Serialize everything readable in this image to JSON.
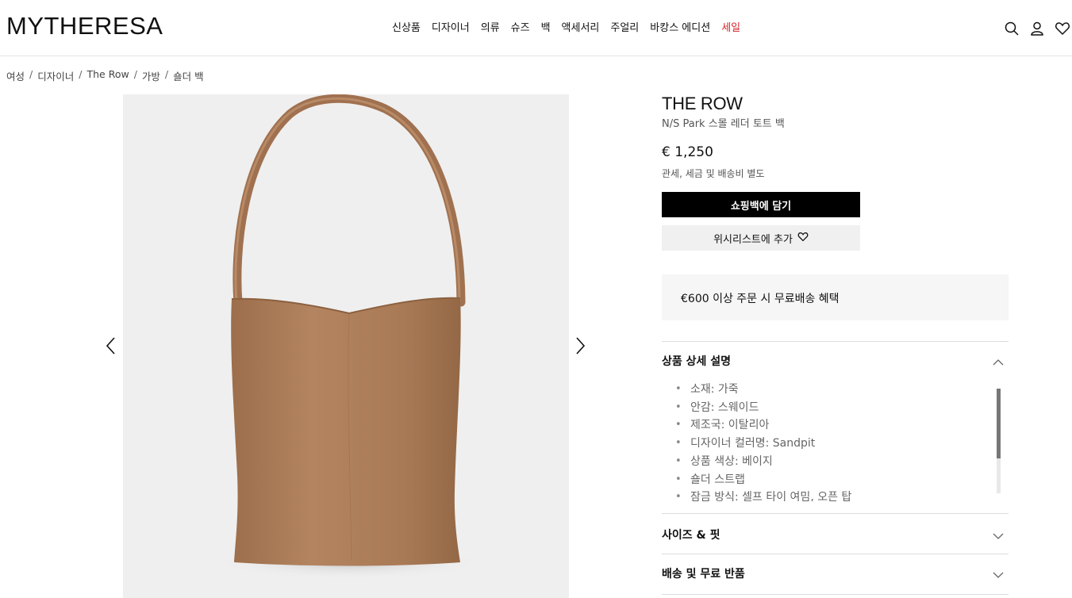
{
  "header": {
    "logo": "MYTHERESA",
    "nav": [
      {
        "label": "신상품"
      },
      {
        "label": "디자이너"
      },
      {
        "label": "의류"
      },
      {
        "label": "슈즈"
      },
      {
        "label": "백"
      },
      {
        "label": "액세서리"
      },
      {
        "label": "주얼리"
      },
      {
        "label": "바캉스 에디션"
      },
      {
        "label": "세일"
      }
    ],
    "icons": [
      "search-icon",
      "account-icon",
      "wishlist-icon"
    ]
  },
  "breadcrumb": [
    "여성",
    "디자이너",
    "The Row",
    "가방",
    "숄더 백"
  ],
  "product": {
    "brand": "THE ROW",
    "name": "N/S Park 스몰 레더 토트 백",
    "price": "€ 1,250",
    "tax_note": "관세, 세금 및 배송비 별도",
    "add_to_bag": "쇼핑백에 담기",
    "add_to_wishlist": "위시리스트에 추가",
    "promo": "€600 이상 주문 시 무료배송 혜택",
    "image_color": "#a97a56"
  },
  "accordion": {
    "details_title": "상품 상세 설명",
    "details": [
      "소재: 가죽",
      "안감: 스웨이드",
      "제조국: 이탈리아",
      "디자이너 컬러명: Sandpit",
      "상품 색상: 베이지",
      "숄더 스트랩",
      "잠금 방식: 셀프 타이 여밈, 오픈 탑"
    ],
    "size_title": "사이즈 & 핏",
    "shipping_title": "배송 및 무료 반품"
  }
}
